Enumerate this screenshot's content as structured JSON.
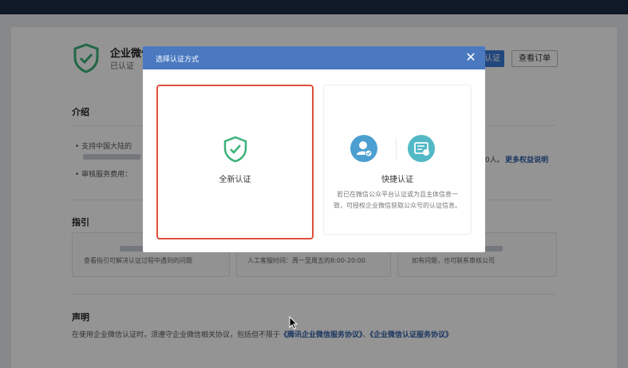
{
  "header": {
    "title": "企业微信",
    "status": "已认证"
  },
  "actions": {
    "primary_label": "认证",
    "orders_label": "查看订单"
  },
  "intro": {
    "section_title": "介绍",
    "bullet1": "支持中国大陆的",
    "bullet2": "审核服务费用：",
    "right_text": "0人。",
    "link": "更多权益说明"
  },
  "guide": {
    "section_title": "指引",
    "box1_text": "查看指引可解决认证过程中遇到的问题",
    "box2_text": "人工客服时间：周一至周五的8:00-20:00",
    "box3_text": "如有问题，也可联系审核公司"
  },
  "declaration": {
    "section_title": "声明",
    "text": "在使用企业微信认证时，须遵守企业微信相关协议，包括但不限于",
    "link1": "《腾讯企业微信服务协议》",
    "sep": "、",
    "link2": "《企业微信认证服务协议》"
  },
  "modal": {
    "title": "选择认证方式",
    "close_symbol": "✕",
    "option_new": {
      "label": "全新认证",
      "icon": "shield-check-icon"
    },
    "option_fast": {
      "label": "快捷认证",
      "description": "若已在微信公众平台认证或为且主体信息一致，可授权企业微信获取公众号的认证信息。",
      "icons": [
        "user-check-icon",
        "id-card-icon"
      ]
    }
  },
  "colors": {
    "topbar": "#1c2b45",
    "modal_header": "#4a79c0",
    "selected_border": "#e0503c",
    "shield_green": "#3bb27a",
    "link_blue": "#2f5fa8"
  }
}
